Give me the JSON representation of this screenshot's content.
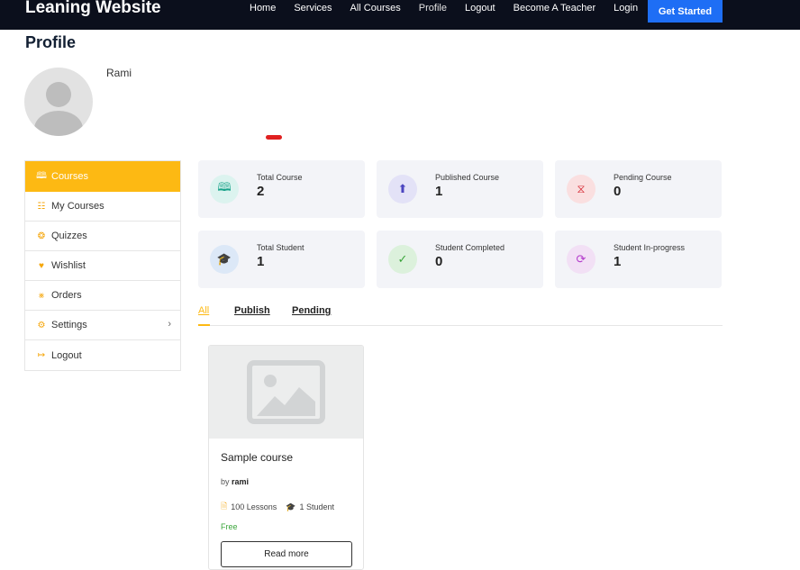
{
  "header": {
    "brand": "Leaning Website",
    "nav": [
      "Home",
      "Services",
      "All Courses",
      "Profile",
      "Logout",
      "Become A Teacher",
      "Login"
    ],
    "cta": "Get Started"
  },
  "profile": {
    "title": "Profile",
    "username": "Rami"
  },
  "sidebar": {
    "items": [
      {
        "label": "Courses",
        "icon": "book-open-icon"
      },
      {
        "label": "My Courses",
        "icon": "books-icon"
      },
      {
        "label": "Quizzes",
        "icon": "puzzle-icon"
      },
      {
        "label": "Wishlist",
        "icon": "heart-icon"
      },
      {
        "label": "Orders",
        "icon": "cart-icon"
      },
      {
        "label": "Settings",
        "icon": "gear-icon"
      },
      {
        "label": "Logout",
        "icon": "logout-icon"
      }
    ]
  },
  "stats": [
    {
      "label": "Total Course",
      "value": "2",
      "icon": "book-icon"
    },
    {
      "label": "Published Course",
      "value": "1",
      "icon": "publish-icon"
    },
    {
      "label": "Pending Course",
      "value": "0",
      "icon": "pending-icon"
    },
    {
      "label": "Total Student",
      "value": "1",
      "icon": "graduation-cap-icon"
    },
    {
      "label": "Student Completed",
      "value": "0",
      "icon": "completed-icon"
    },
    {
      "label": "Student In-progress",
      "value": "1",
      "icon": "progress-icon"
    }
  ],
  "tabs": [
    "All",
    "Publish",
    "Pending"
  ],
  "course": {
    "title": "Sample course",
    "by_prefix": "by",
    "author": "rami",
    "lessons": "100 Lessons",
    "students": "1 Student",
    "price": "Free",
    "button": "Read more"
  },
  "colors": {
    "accent": "#fdb913",
    "cta": "#1e6ef5",
    "topbar": "#0b0f1c"
  }
}
